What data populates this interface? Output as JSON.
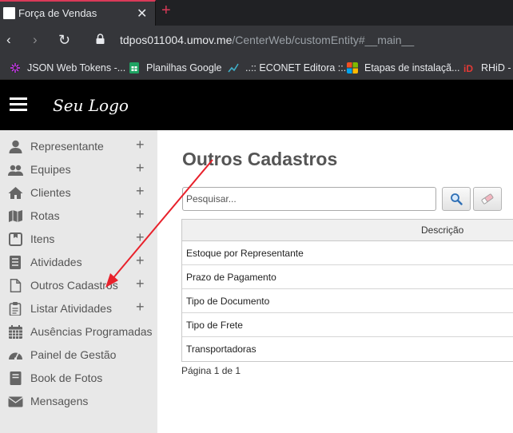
{
  "browser": {
    "tab_title": "Força de Vendas",
    "tab_close": "✕",
    "new_tab": "+",
    "url_host": "tdpos011004.umov.me",
    "url_path": "/CenterWeb/customEntity#__main__",
    "bookmarks": [
      {
        "label": "JSON Web Tokens -...",
        "color": "#5a2ea6"
      },
      {
        "label": "Planilhas Google",
        "color": "#1fa463"
      },
      {
        "label": "..:: ECONET Editora ::..",
        "color": "#3fb0c9"
      },
      {
        "label": "Etapas de instalaçã...",
        "color": "#f25022"
      },
      {
        "label": "RHiD -",
        "color": "#e53935"
      }
    ]
  },
  "header": {
    "logo": "Seu Logo"
  },
  "sidebar": {
    "items": [
      {
        "label": "Representante",
        "icon": "user-icon",
        "plus": "+"
      },
      {
        "label": "Equipes",
        "icon": "users-icon",
        "plus": "+"
      },
      {
        "label": "Clientes",
        "icon": "home-icon",
        "plus": "+"
      },
      {
        "label": "Rotas",
        "icon": "map-icon",
        "plus": "+"
      },
      {
        "label": "Itens",
        "icon": "box-icon",
        "plus": "+"
      },
      {
        "label": "Atividades",
        "icon": "list-icon",
        "plus": "+"
      },
      {
        "label": "Outros Cadastros",
        "icon": "file-icon",
        "plus": "+"
      },
      {
        "label": "Listar Atividades",
        "icon": "clipboard-icon",
        "plus": "+"
      },
      {
        "label": "Ausências Programadas",
        "icon": "calendar-icon"
      },
      {
        "label": "Painel de Gestão",
        "icon": "dashboard-icon"
      },
      {
        "label": "Book de Fotos",
        "icon": "book-icon"
      },
      {
        "label": "Mensagens",
        "icon": "envelope-icon"
      }
    ]
  },
  "main": {
    "title": "Outros Cadastros",
    "search_placeholder": "Pesquisar...",
    "table": {
      "header": "Descrição",
      "rows": [
        "Estoque por Representante",
        "Prazo de Pagamento",
        "Tipo de Documento",
        "Tipo de Frete",
        "Transportadoras"
      ]
    },
    "pager": "Página 1 de 1"
  },
  "colors": {
    "accent_tab": "#d93a58",
    "annotation_arrow": "#e8212b",
    "header_bg": "#000000",
    "sidebar_bg": "#e8e8e8"
  }
}
